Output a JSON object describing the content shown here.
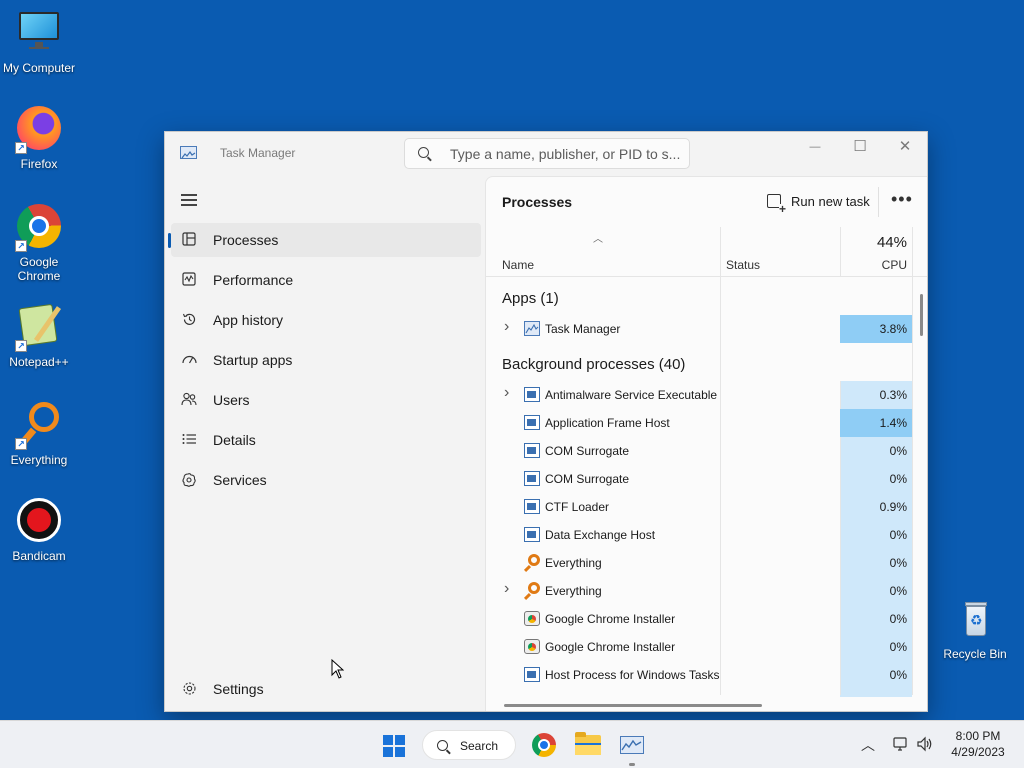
{
  "desktop": {
    "icons": [
      {
        "label": "My Computer"
      },
      {
        "label": "Firefox"
      },
      {
        "label": "Google Chrome"
      },
      {
        "label": "Notepad++"
      },
      {
        "label": "Everything"
      },
      {
        "label": "Bandicam"
      },
      {
        "label": "Recycle Bin"
      }
    ]
  },
  "window": {
    "title": "Task Manager",
    "search_placeholder": "Type a name, publisher, or PID to s...",
    "controls": {
      "minimize": "—",
      "maximize": "☐",
      "close": "✕"
    }
  },
  "sidebar": {
    "items": [
      {
        "label": "Processes",
        "icon": "processes-icon",
        "active": true
      },
      {
        "label": "Performance",
        "icon": "performance-icon"
      },
      {
        "label": "App history",
        "icon": "history-icon"
      },
      {
        "label": "Startup apps",
        "icon": "startup-icon"
      },
      {
        "label": "Users",
        "icon": "users-icon"
      },
      {
        "label": "Details",
        "icon": "details-icon"
      },
      {
        "label": "Services",
        "icon": "services-icon"
      }
    ],
    "settings_label": "Settings"
  },
  "main": {
    "title": "Processes",
    "run_new_task": "Run new task",
    "more": "•••",
    "columns": {
      "name": "Name",
      "status": "Status",
      "cpu_total": "44%",
      "cpu": "CPU"
    },
    "groups": {
      "apps": "Apps (1)",
      "background": "Background processes (40)"
    },
    "apps": [
      {
        "name": "Task Manager",
        "cpu": "3.8%",
        "expandable": true,
        "icon": "taskmanager-icon"
      }
    ],
    "background": [
      {
        "name": "Antimalware Service Executable",
        "cpu": "0.3%",
        "expandable": true,
        "icon": "window-icon"
      },
      {
        "name": "Application Frame Host",
        "cpu": "1.4%",
        "expandable": false,
        "icon": "window-icon"
      },
      {
        "name": "COM Surrogate",
        "cpu": "0%",
        "expandable": false,
        "icon": "window-icon"
      },
      {
        "name": "COM Surrogate",
        "cpu": "0%",
        "expandable": false,
        "icon": "window-icon"
      },
      {
        "name": "CTF Loader",
        "cpu": "0.9%",
        "expandable": false,
        "icon": "window-icon"
      },
      {
        "name": "Data Exchange Host",
        "cpu": "0%",
        "expandable": false,
        "icon": "window-icon"
      },
      {
        "name": "Everything",
        "cpu": "0%",
        "expandable": false,
        "icon": "everything-icon"
      },
      {
        "name": "Everything",
        "cpu": "0%",
        "expandable": true,
        "icon": "everything-icon"
      },
      {
        "name": "Google Chrome Installer",
        "cpu": "0%",
        "expandable": false,
        "icon": "installer-icon"
      },
      {
        "name": "Google Chrome Installer",
        "cpu": "0%",
        "expandable": false,
        "icon": "installer-icon"
      },
      {
        "name": "Host Process for Windows Tasks",
        "cpu": "0%",
        "expandable": false,
        "icon": "window-icon"
      }
    ],
    "highlight_color": "#8fcdf5",
    "cpu_column_color": "#cfe8fa"
  },
  "taskbar": {
    "search_label": "Search",
    "time": "8:00 PM",
    "date": "4/29/2023"
  }
}
